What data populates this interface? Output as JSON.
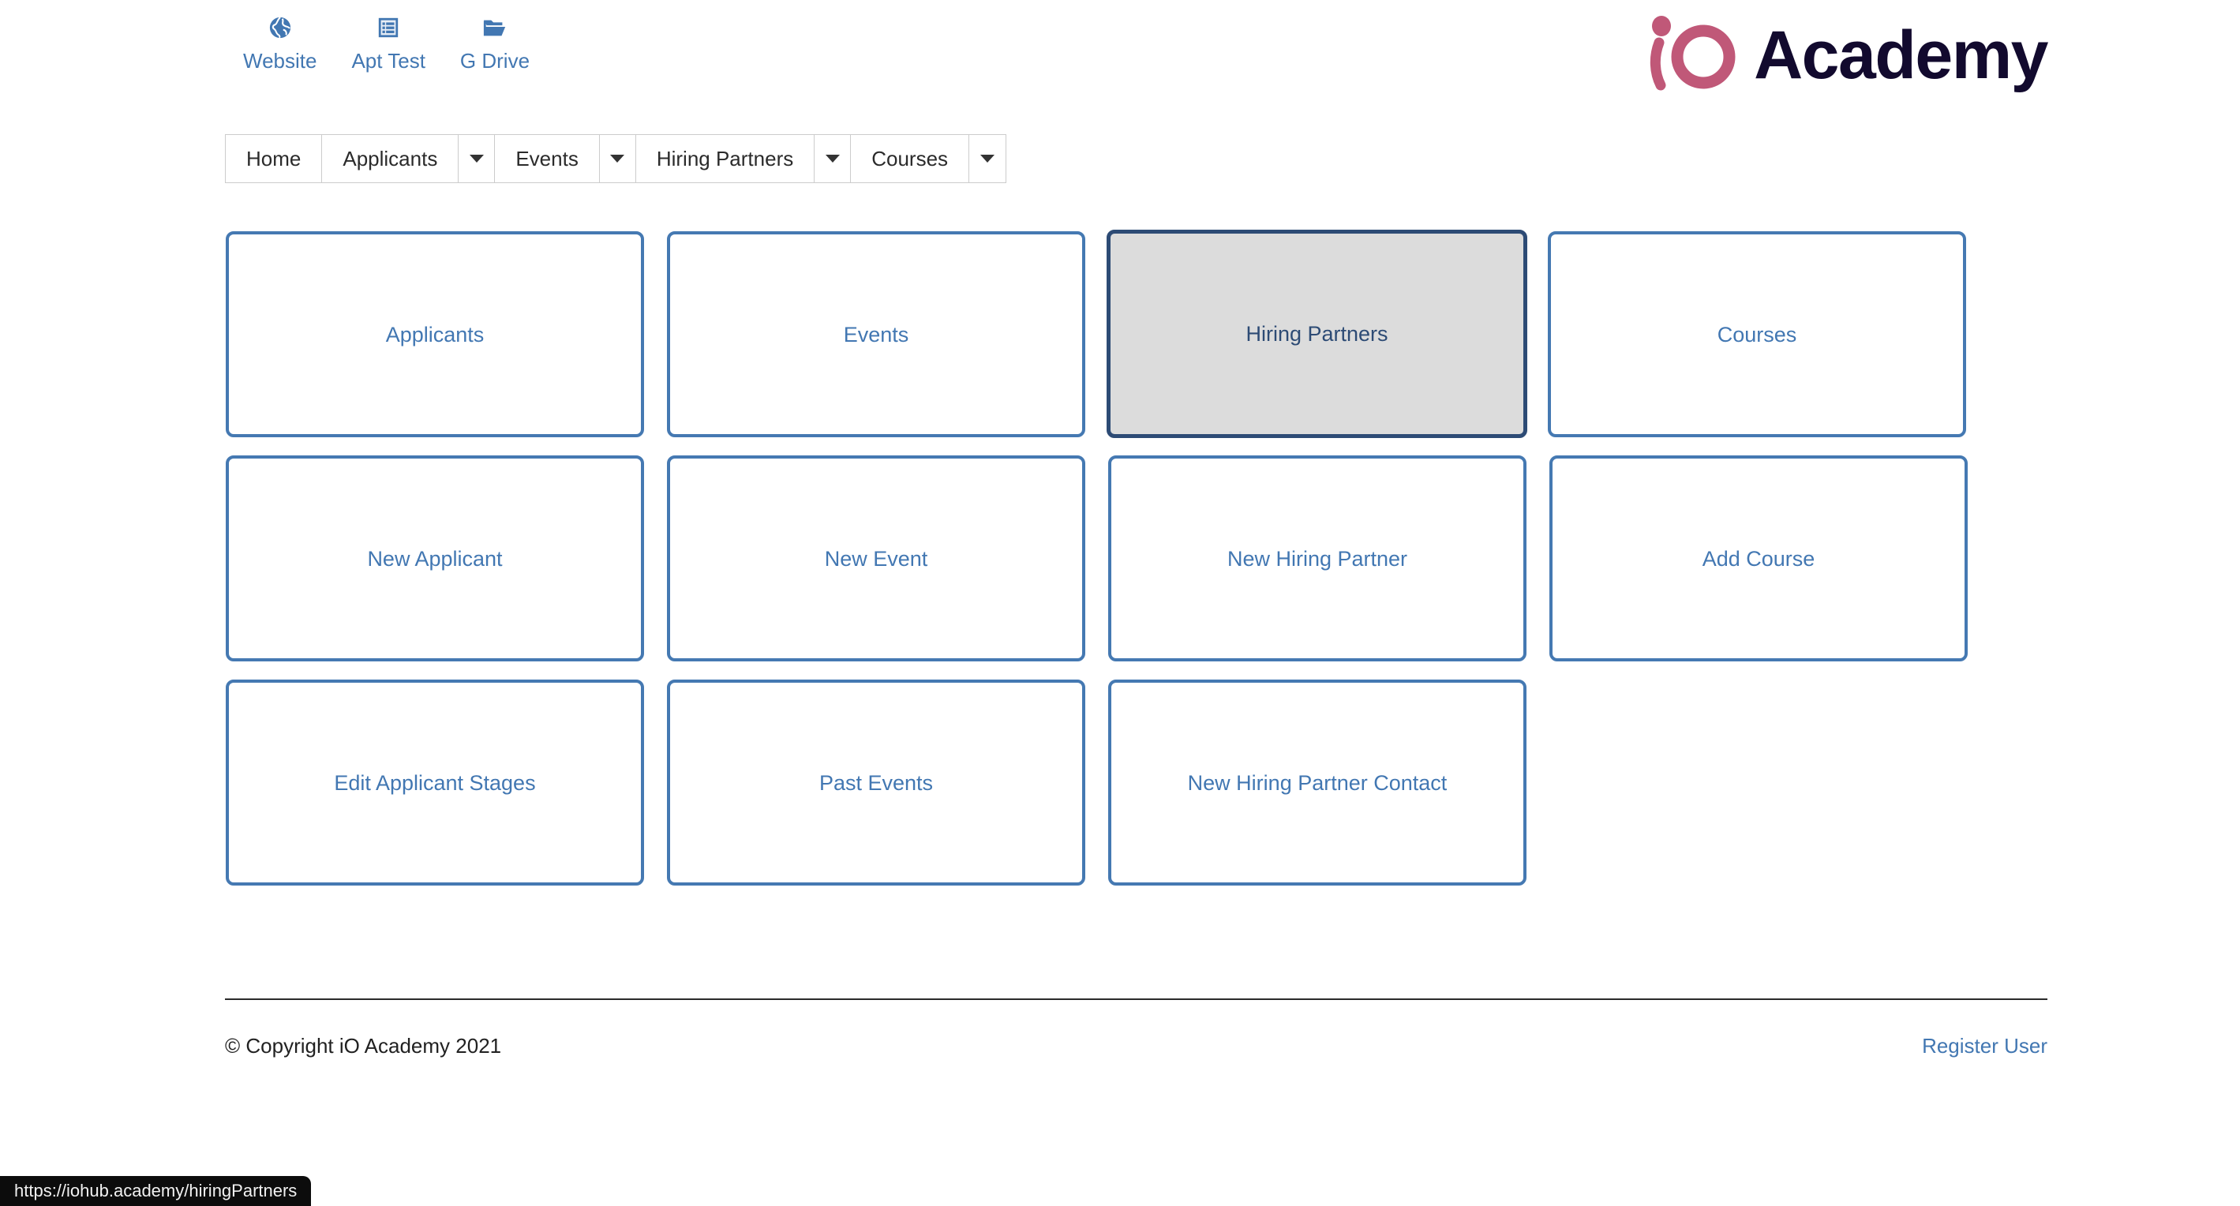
{
  "quicklinks": [
    {
      "label": "Website",
      "icon": "globe-icon"
    },
    {
      "label": "Apt Test",
      "icon": "list-form-icon"
    },
    {
      "label": "G Drive",
      "icon": "open-folder-icon"
    }
  ],
  "logo": {
    "mark_text": "iO",
    "word": "Academy",
    "mark_color": "#c05878",
    "word_color": "#120a2e"
  },
  "nav": {
    "items": [
      {
        "label": "Home",
        "caret": false
      },
      {
        "label": "Applicants",
        "caret": true
      },
      {
        "label": "Events",
        "caret": true
      },
      {
        "label": "Hiring Partners",
        "caret": true
      },
      {
        "label": "Courses",
        "caret": true
      }
    ],
    "caret_icon": "chevron-down-icon"
  },
  "cards": [
    {
      "label": "Applicants",
      "state": "normal"
    },
    {
      "label": "Events",
      "state": "normal"
    },
    {
      "label": "Hiring Partners",
      "state": "active"
    },
    {
      "label": "Courses",
      "state": "normal"
    },
    {
      "label": "New Applicant",
      "state": "normal"
    },
    {
      "label": "New Event",
      "state": "normal"
    },
    {
      "label": "New Hiring Partner",
      "state": "normal"
    },
    {
      "label": "Add Course",
      "state": "normal"
    },
    {
      "label": "Edit Applicant Stages",
      "state": "normal"
    },
    {
      "label": "Past Events",
      "state": "normal"
    },
    {
      "label": "New Hiring Partner Contact",
      "state": "normal"
    },
    {
      "label": "",
      "state": "empty"
    }
  ],
  "footer": {
    "copyright": "© Copyright iO Academy 2021",
    "register_link": "Register User"
  },
  "statusbar": {
    "text": "https://iohub.academy/hiringPartners"
  },
  "colors": {
    "link_blue": "#4277b2",
    "card_border": "#4579b2",
    "card_active_border": "#2d4b75",
    "card_active_bg": "#dcdcdc",
    "nav_border": "#cccccc",
    "text_dark": "#212121"
  }
}
